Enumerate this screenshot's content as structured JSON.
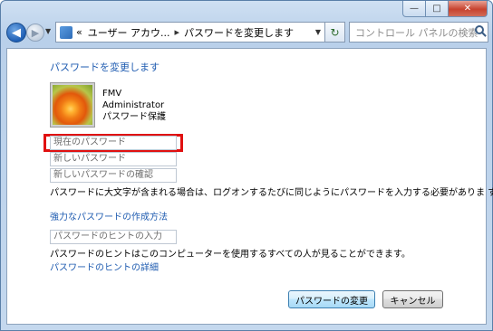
{
  "window": {
    "min_glyph": "—",
    "max_glyph": "□",
    "close_glyph": "✕"
  },
  "nav": {
    "back_glyph": "◀",
    "forward_glyph": "▶",
    "dropdown_glyph": "▼",
    "address": {
      "overflow": "«",
      "crumb_1": "ユーザー アカウ...",
      "separator": "▸",
      "crumb_2": "パスワードを変更します",
      "dropdown_glyph": "▼"
    },
    "refresh_glyph": "↻",
    "search_placeholder": "コントロール パネルの検索"
  },
  "content": {
    "heading": "パスワードを変更します",
    "user": {
      "name": "FMV",
      "type": "Administrator",
      "status": "パスワード保護"
    },
    "fields": {
      "current_password": "現在のパスワード",
      "new_password": "新しいパスワード",
      "confirm_password": "新しいパスワードの確認",
      "hint": "パスワードのヒントの入力"
    },
    "caps_note": "パスワードに大文字が含まれる場合は、ログオンするたびに同じようにパスワードを入力する必要がありま す。",
    "strong_link": "強力なパスワードの作成方法",
    "hint_note": "パスワードのヒントはこのコンピューターを使用するすべての人が見ることができます。",
    "hint_link": "パスワードのヒントの詳細",
    "buttons": {
      "change": "パスワードの変更",
      "cancel": "キャンセル"
    },
    "highlight_color": "#e01010",
    "link_color": "#1e5bb0"
  }
}
